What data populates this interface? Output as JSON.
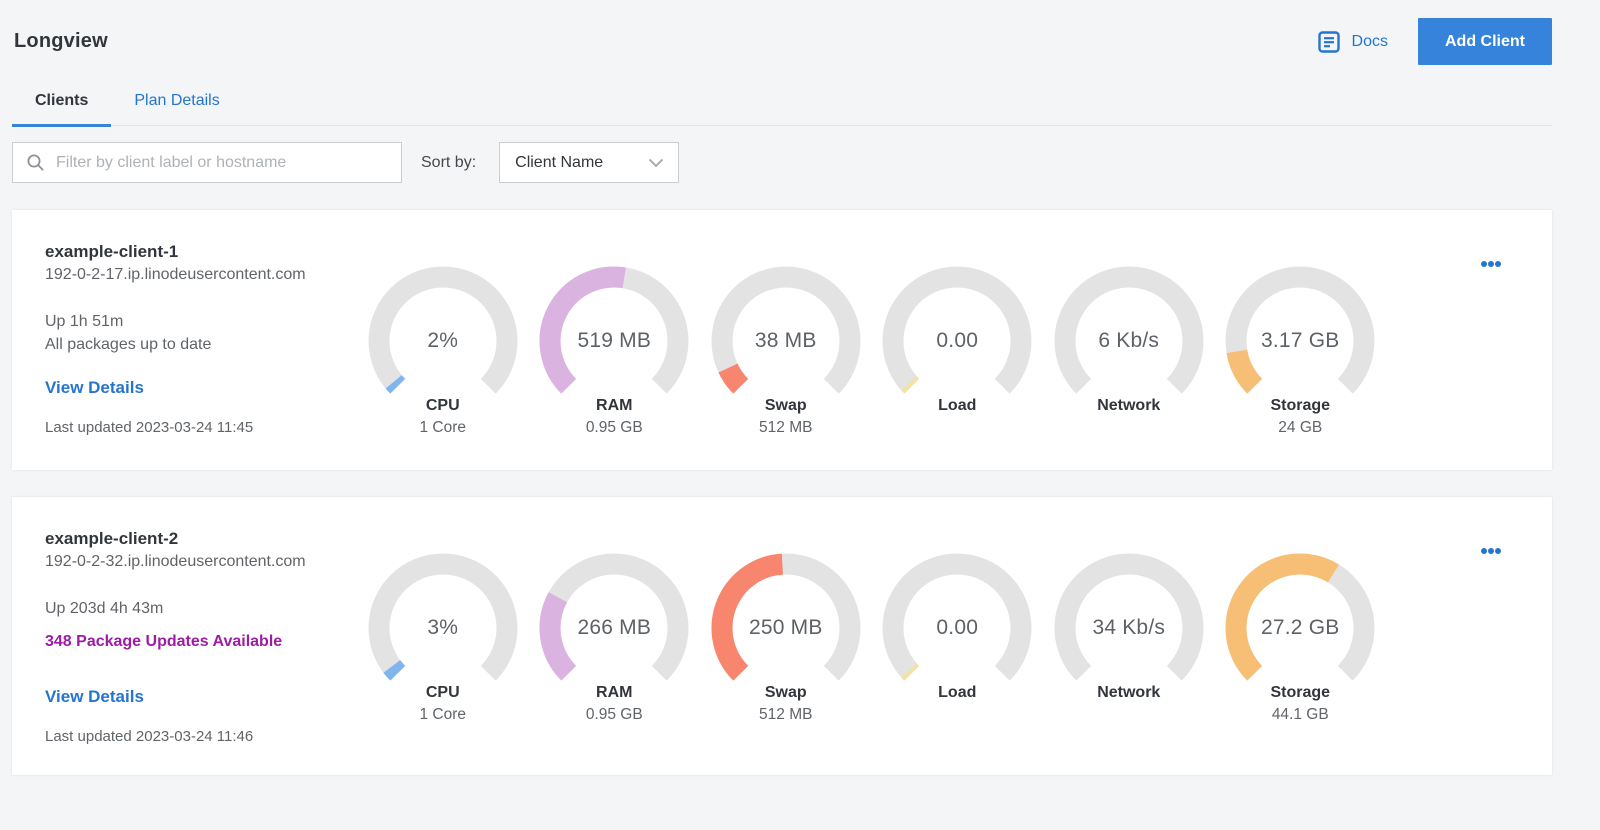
{
  "page": {
    "title": "Longview",
    "docs_label": "Docs",
    "add_client_label": "Add Client",
    "tabs": [
      {
        "label": "Clients",
        "active": true
      },
      {
        "label": "Plan Details",
        "active": false
      }
    ],
    "filter_placeholder": "Filter by client label or hostname",
    "sort_by_label": "Sort by:",
    "sort_value": "Client Name"
  },
  "colors": {
    "accent_button": "#3683dc",
    "link_blue": "#2575d0",
    "tab_underline": "#3683dc",
    "text_primary": "#32363c",
    "text_secondary": "#606469",
    "package_alert_purple": "#9e1ba6",
    "gauge_track": "#e3e3e3",
    "gauge_cpu": "#80b5ee",
    "gauge_ram": "#dab3e0",
    "gauge_swap": "#f8866e",
    "gauge_load": "#f3e2a3",
    "gauge_storage": "#f6bf75"
  },
  "gauge_geometry": {
    "start_deg": 225,
    "span_deg": 270
  },
  "clients": [
    {
      "name": "example-client-1",
      "hostname": "192-0-2-17.ip.linodeusercontent.com",
      "uptime": "Up 1h 51m",
      "packages_status": "All packages up to date",
      "packages_alert": false,
      "view_details_label": "View Details",
      "last_updated": "Last updated 2023-03-24 11:45",
      "gauges": [
        {
          "metric": "cpu",
          "value": "2%",
          "label": "CPU",
          "sublabel": "1 Core",
          "fraction": 0.02,
          "color_key": "gauge_cpu"
        },
        {
          "metric": "ram",
          "value": "519 MB",
          "label": "RAM",
          "sublabel": "0.95 GB",
          "fraction": 0.534,
          "color_key": "gauge_ram"
        },
        {
          "metric": "swap",
          "value": "38 MB",
          "label": "Swap",
          "sublabel": "512 MB",
          "fraction": 0.074,
          "color_key": "gauge_swap"
        },
        {
          "metric": "load",
          "value": "0.00",
          "label": "Load",
          "sublabel": "",
          "fraction": 0.013,
          "color_key": "gauge_load"
        },
        {
          "metric": "network",
          "value": "6 Kb/s",
          "label": "Network",
          "sublabel": "",
          "fraction": 0,
          "color_key": "gauge_cpu"
        },
        {
          "metric": "storage",
          "value": "3.17 GB",
          "label": "Storage",
          "sublabel": "24 GB",
          "fraction": 0.132,
          "color_key": "gauge_storage"
        }
      ]
    },
    {
      "name": "example-client-2",
      "hostname": "192-0-2-32.ip.linodeusercontent.com",
      "uptime": "Up 203d 4h 43m",
      "packages_status": "348 Package Updates Available",
      "packages_alert": true,
      "view_details_label": "View Details",
      "last_updated": "Last updated 2023-03-24 11:46",
      "gauges": [
        {
          "metric": "cpu",
          "value": "3%",
          "label": "CPU",
          "sublabel": "1 Core",
          "fraction": 0.03,
          "color_key": "gauge_cpu"
        },
        {
          "metric": "ram",
          "value": "266 MB",
          "label": "RAM",
          "sublabel": "0.95 GB",
          "fraction": 0.273,
          "color_key": "gauge_ram"
        },
        {
          "metric": "swap",
          "value": "250 MB",
          "label": "Swap",
          "sublabel": "512 MB",
          "fraction": 0.488,
          "color_key": "gauge_swap"
        },
        {
          "metric": "load",
          "value": "0.00",
          "label": "Load",
          "sublabel": "",
          "fraction": 0.013,
          "color_key": "gauge_load"
        },
        {
          "metric": "network",
          "value": "34 Kb/s",
          "label": "Network",
          "sublabel": "",
          "fraction": 0,
          "color_key": "gauge_cpu"
        },
        {
          "metric": "storage",
          "value": "27.2 GB",
          "label": "Storage",
          "sublabel": "44.1 GB",
          "fraction": 0.617,
          "color_key": "gauge_storage"
        }
      ]
    }
  ]
}
